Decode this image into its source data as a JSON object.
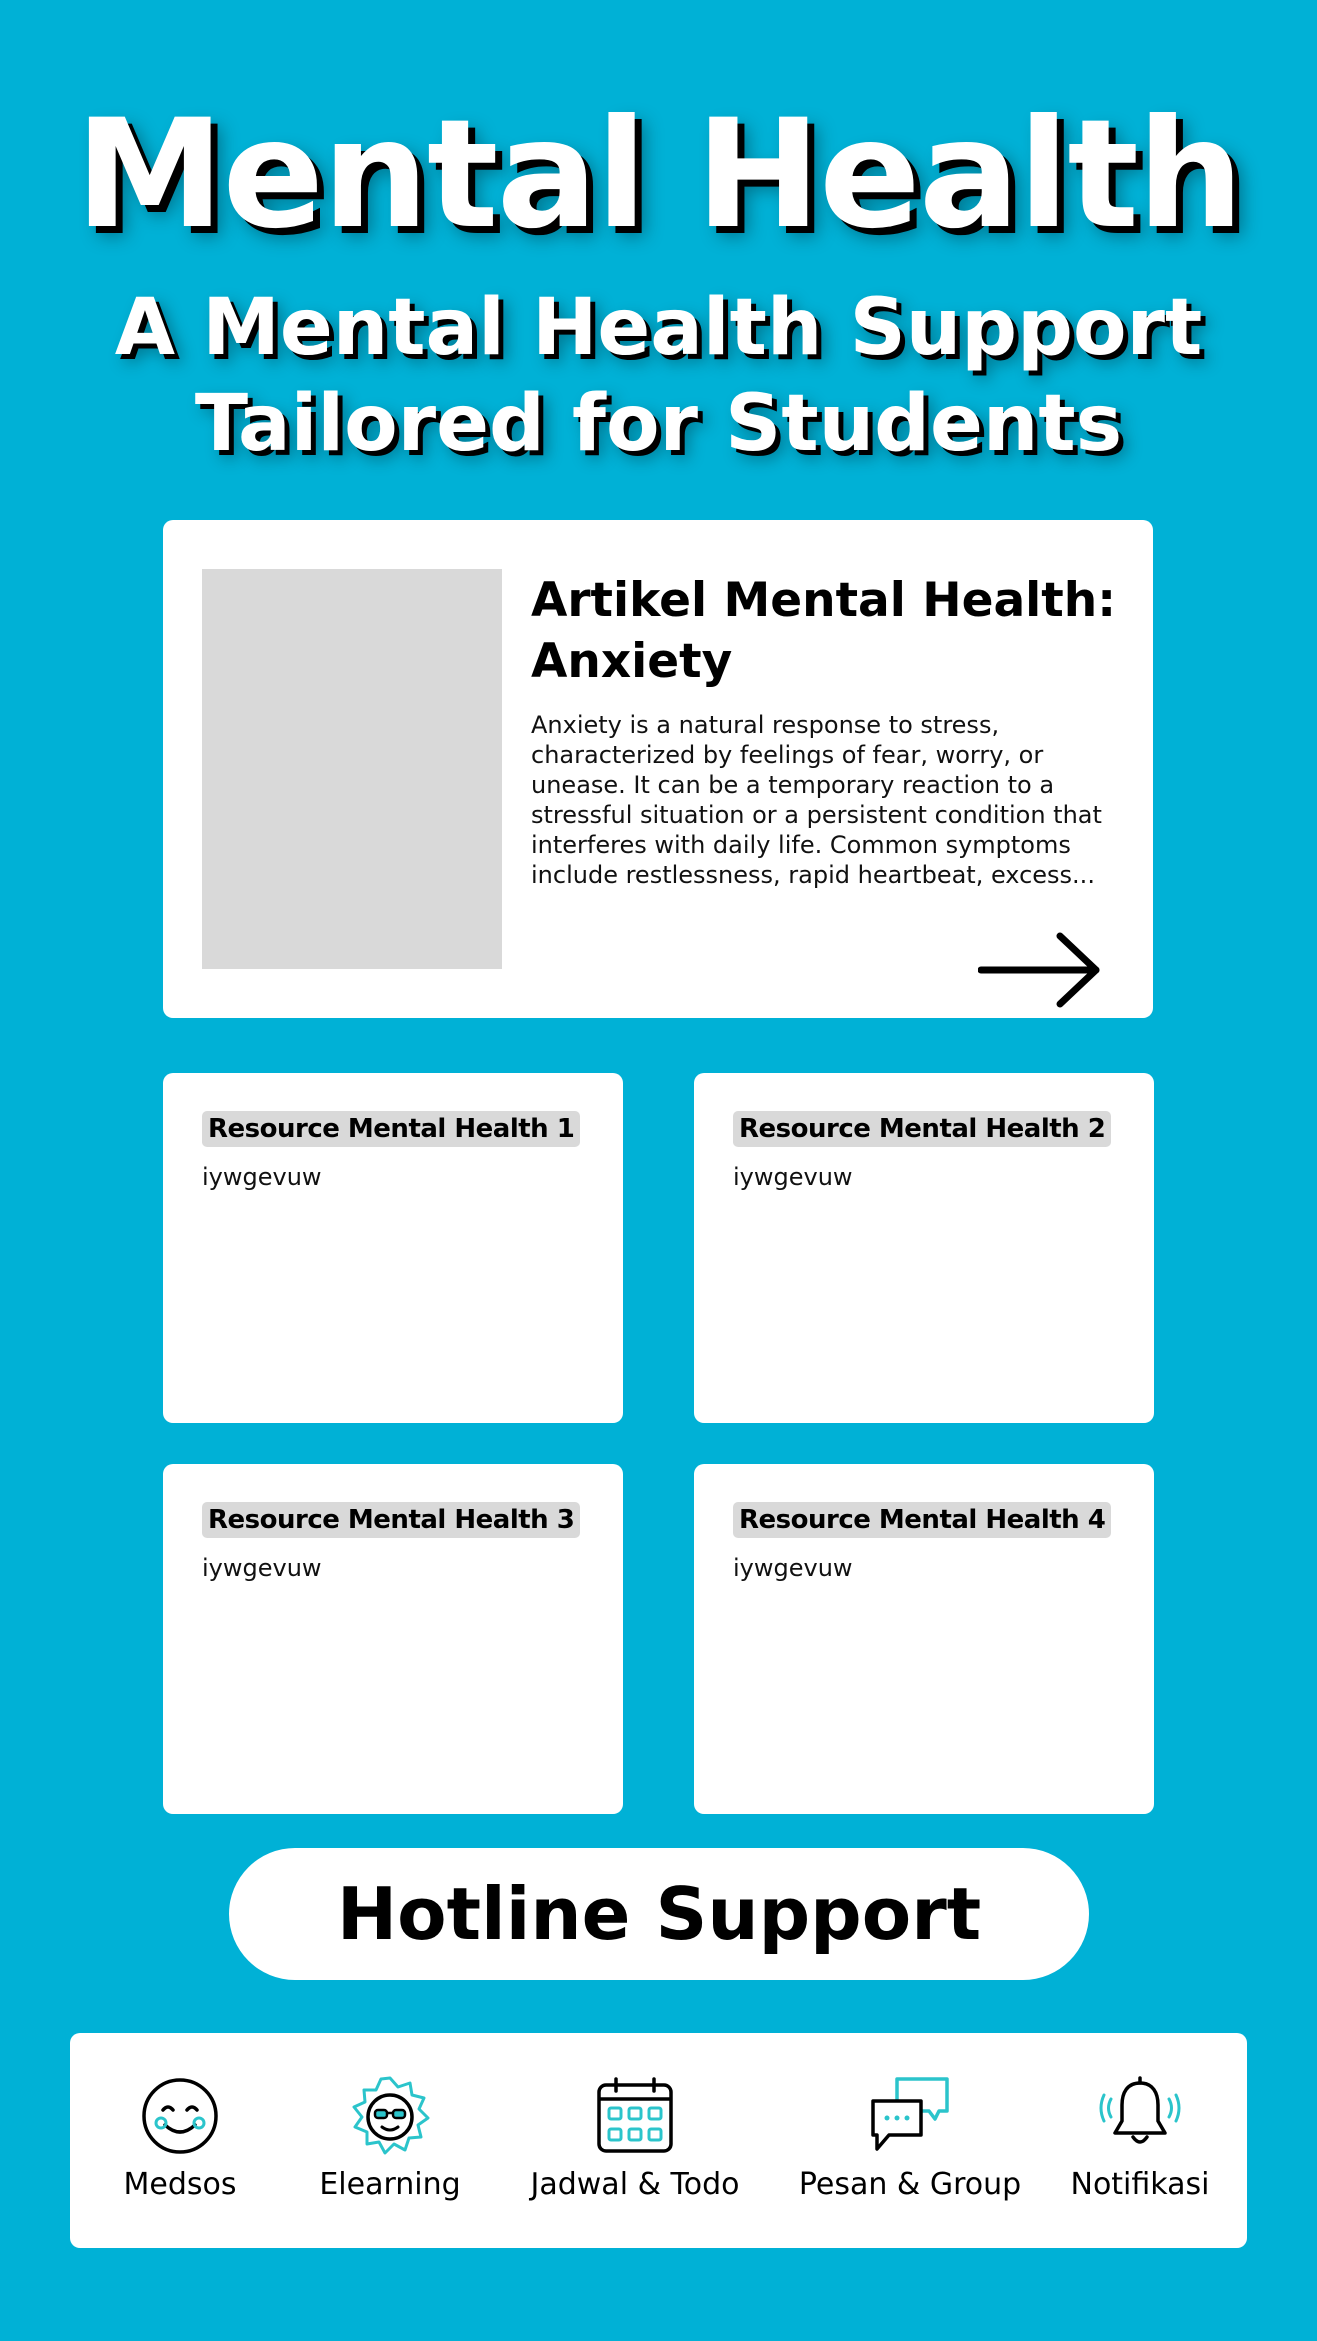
{
  "hero": {
    "title": "Mental Health",
    "subtitle_line1": "A Mental Health Support",
    "subtitle_line2": "Tailored for Students"
  },
  "article": {
    "title": "Artikel Mental Health: Anxiety",
    "body": "Anxiety is a natural response to stress, characterized by feelings of fear, worry, or unease. It can be a temporary reaction to a stressful situation or a persistent condition that interferes with daily life. Common symptoms include restlessness, rapid heartbeat, excess..."
  },
  "resources": [
    {
      "title": "Resource Mental Health 1",
      "body": "iywgevuw"
    },
    {
      "title": "Resource Mental Health 2",
      "body": "iywgevuw"
    },
    {
      "title": "Resource Mental Health 3",
      "body": "iywgevuw"
    },
    {
      "title": "Resource Mental Health 4",
      "body": "iywgevuw"
    }
  ],
  "hotline": {
    "label": "Hotline Support"
  },
  "nav": {
    "items": [
      {
        "label": "Medsos",
        "icon": "smile-face-icon"
      },
      {
        "label": "Elearning",
        "icon": "glasses-badge-icon"
      },
      {
        "label": "Jadwal & Todo",
        "icon": "calendar-icon"
      },
      {
        "label": "Pesan & Group",
        "icon": "chat-bubbles-icon"
      },
      {
        "label": "Notifikasi",
        "icon": "bell-ringing-icon"
      }
    ]
  },
  "colors": {
    "background": "#00B1D6",
    "accent": "#2BC4CB",
    "card": "#FFFFFF",
    "placeholder": "#D9D9D9"
  }
}
